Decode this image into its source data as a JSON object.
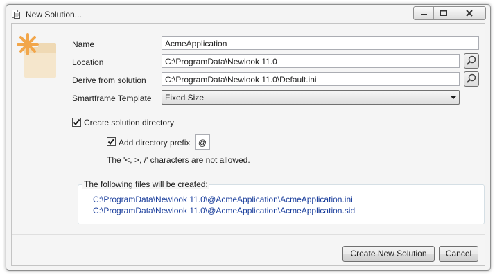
{
  "window": {
    "title": "New Solution...",
    "icons": {
      "app": "app-document-icon",
      "minimize": "minimize-icon",
      "maximize": "maximize-icon",
      "close": "close-icon"
    }
  },
  "form": {
    "header_icon": "folder-star-icon",
    "name": {
      "label": "Name",
      "value": "AcmeApplication"
    },
    "location": {
      "label": "Location",
      "value": "C:\\ProgramData\\Newlook 11.0",
      "browse_icon": "search-icon"
    },
    "derive": {
      "label": "Derive from solution",
      "value": "C:\\ProgramData\\Newlook 11.0\\Default.ini",
      "browse_icon": "search-icon"
    },
    "template": {
      "label": "Smartframe Template",
      "selected": "Fixed Size"
    },
    "create_dir": {
      "label": "Create solution directory",
      "checked": true
    },
    "add_prefix": {
      "label": "Add directory prefix",
      "checked": true,
      "prefix": "@"
    },
    "note": "The '<, >, /' characters are not allowed."
  },
  "files": {
    "title": "The following files will be created:",
    "items": [
      "C:\\ProgramData\\Newlook 11.0\\@AcmeApplication\\AcmeApplication.ini",
      "C:\\ProgramData\\Newlook 11.0\\@AcmeApplication\\AcmeApplication.sid"
    ]
  },
  "buttons": {
    "create": "Create New Solution",
    "cancel": "Cancel"
  },
  "colors": {
    "link": "#1a3e9c",
    "accent_icon": "#f2a64a",
    "folder": "#efd9b4"
  }
}
